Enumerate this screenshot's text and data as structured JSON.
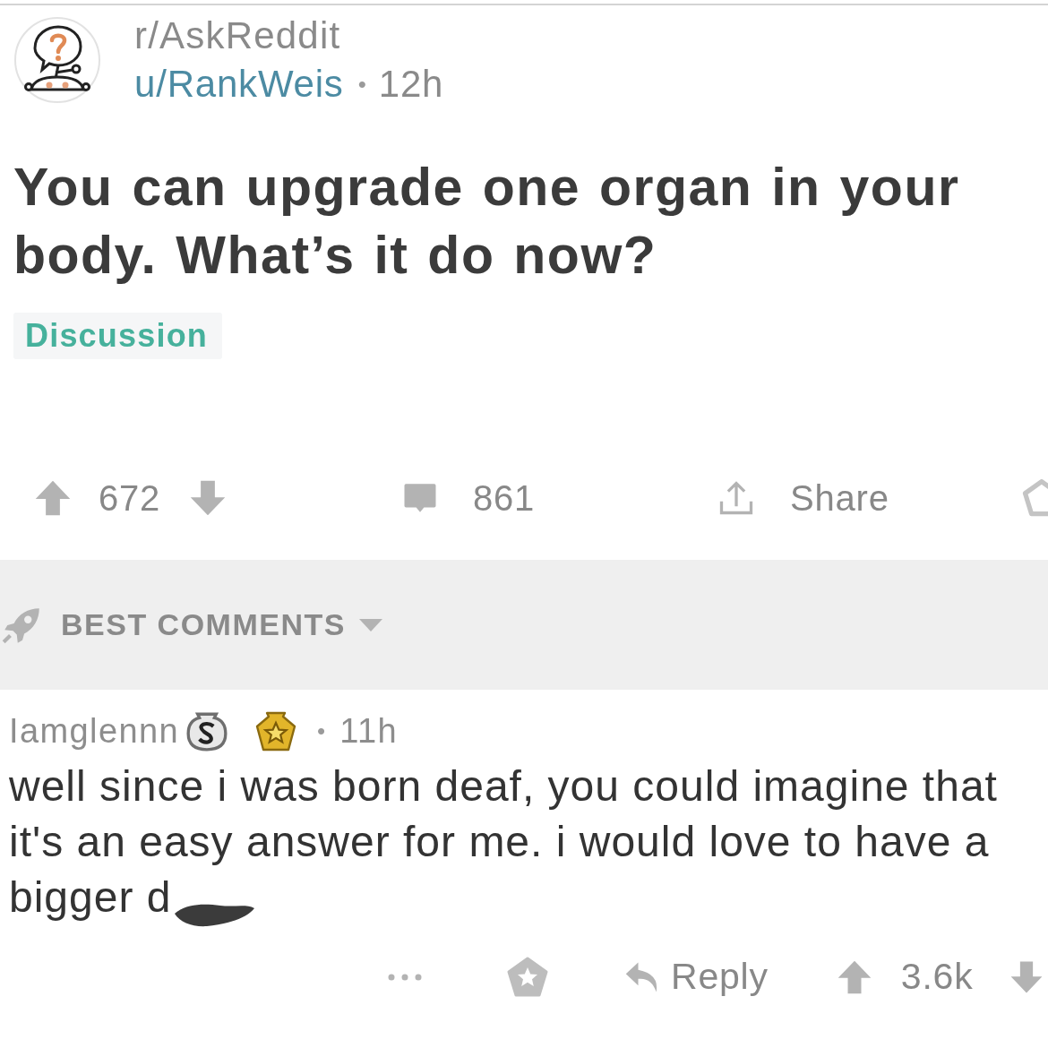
{
  "header": {
    "subreddit": "r/AskReddit",
    "author": "u/RankWeis",
    "separator": "•",
    "age": "12h"
  },
  "post": {
    "title": "You can upgrade one organ in your body. What’s it do now?",
    "flair": "Discussion"
  },
  "post_actions": {
    "score": "672",
    "comments": "861",
    "share": "Share"
  },
  "comments_header": {
    "sort": "BEST COMMENTS"
  },
  "comments": [
    {
      "author": "Iamglennn",
      "badges": [
        {
          "kind": "silver"
        },
        {
          "kind": "gold"
        }
      ],
      "separator": "•",
      "age": "11h",
      "body": "well since i was born deaf, you could imagine that it's an easy answer for me. i would love to have a bigger d",
      "redacted": true,
      "reply": "Reply",
      "score": "3.6k"
    }
  ]
}
